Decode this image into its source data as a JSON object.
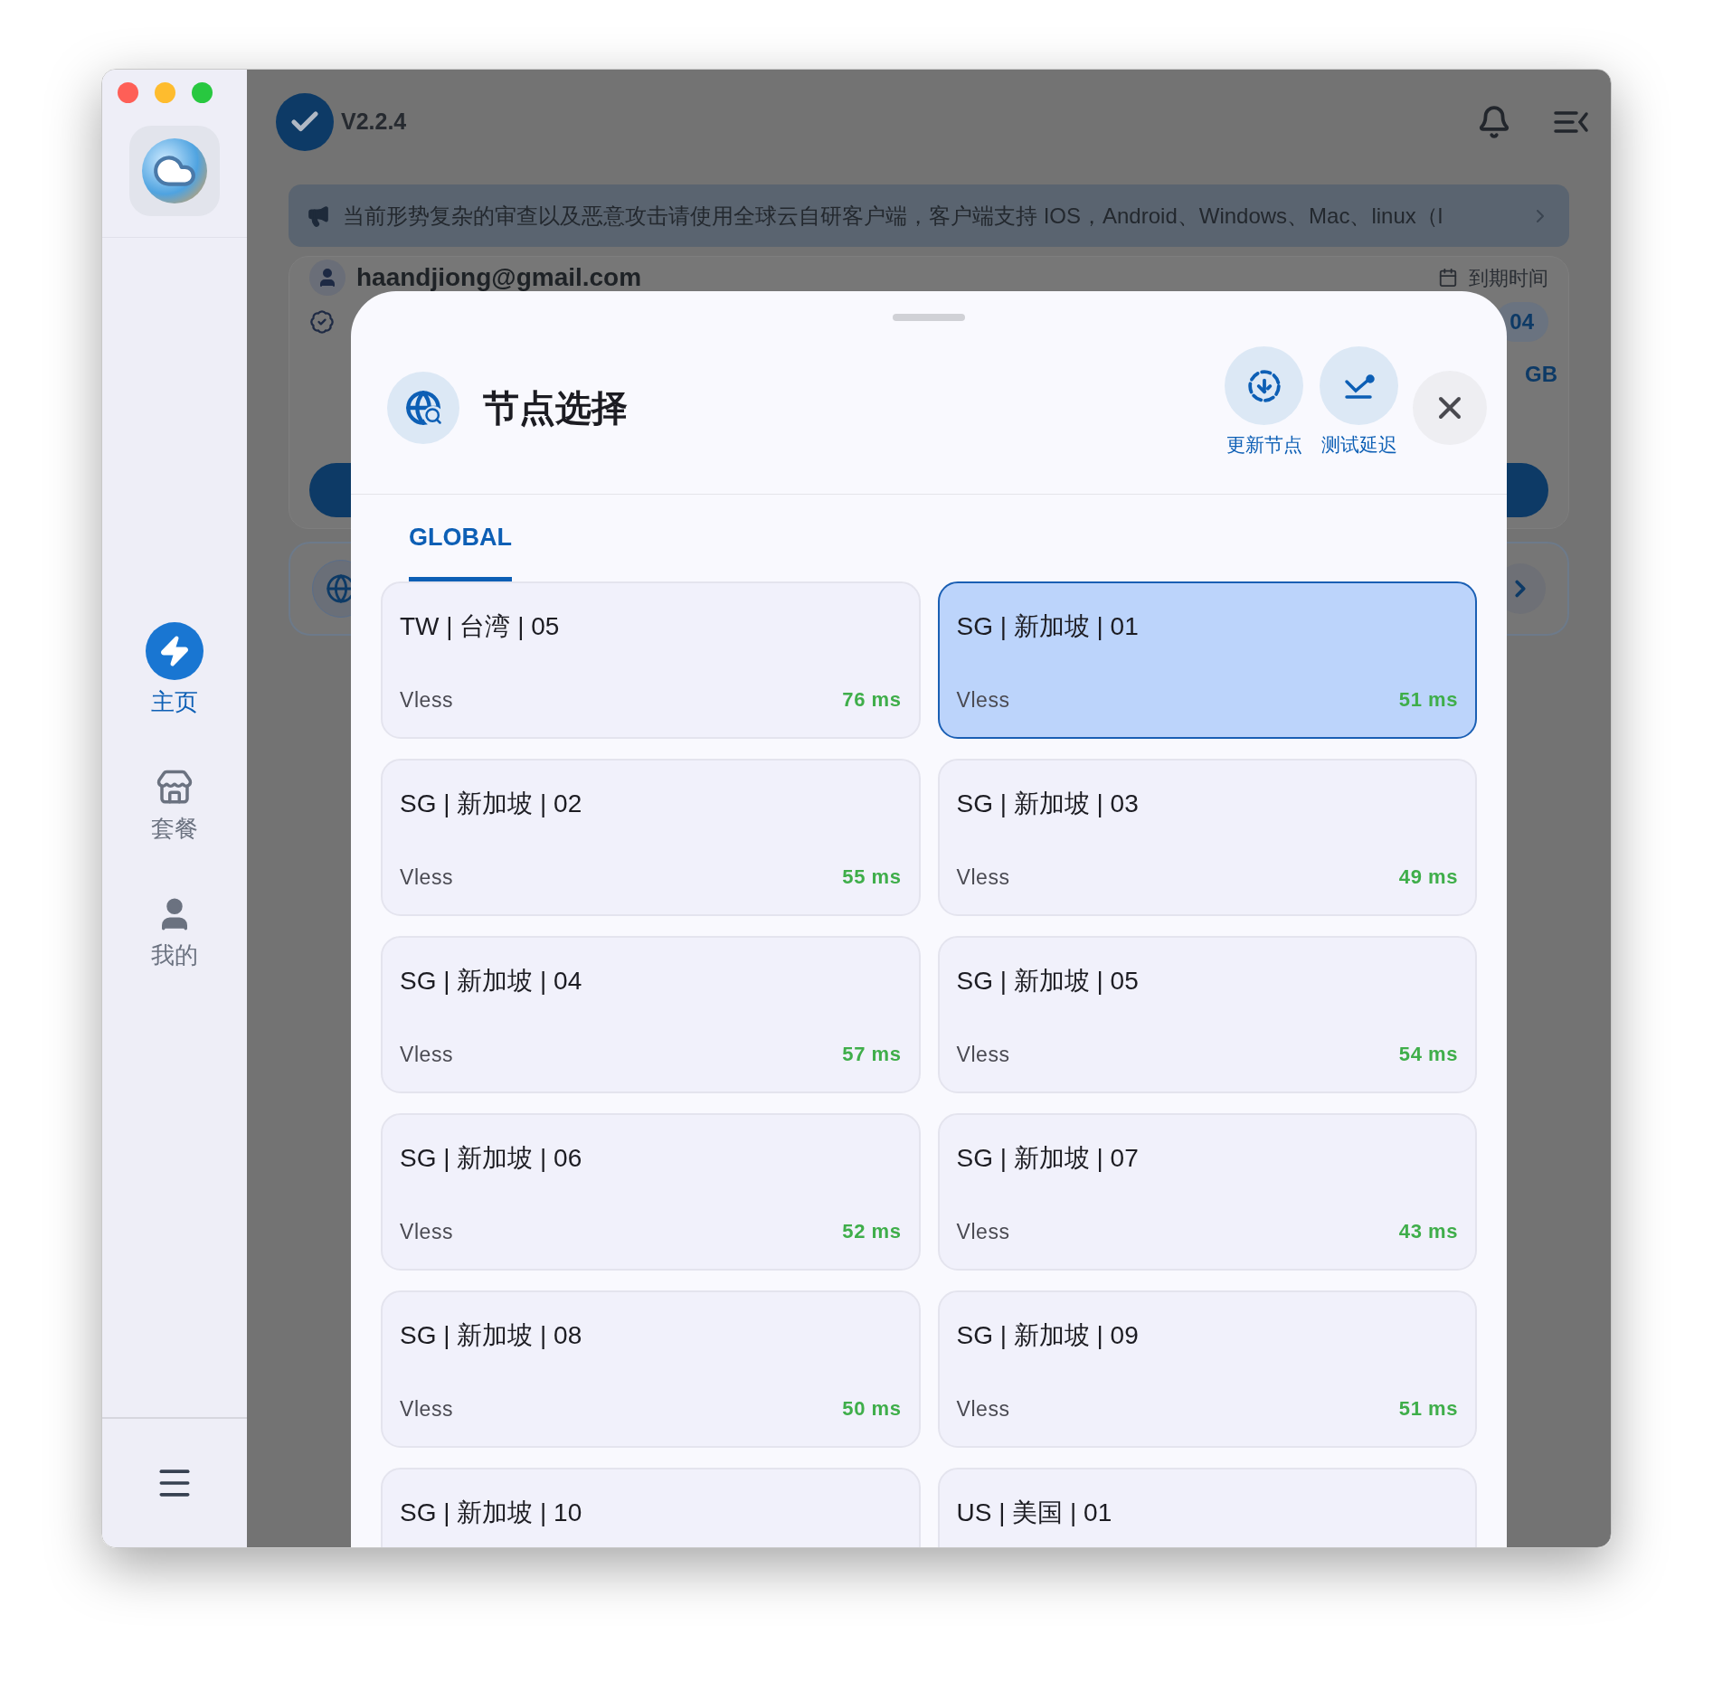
{
  "sidebar": {
    "items": [
      {
        "label": "主页",
        "kind": "home",
        "selected": true
      },
      {
        "label": "套餐",
        "kind": "plans",
        "selected": false
      },
      {
        "label": "我的",
        "kind": "profile",
        "selected": false
      }
    ]
  },
  "header": {
    "version": "V2.2.4"
  },
  "banner": {
    "text": "当前形势复杂的审查以及恶意攻击请使用全球云自研客户端，客户端支持 IOS，Android、Windows、Mac、linux（l"
  },
  "account": {
    "email": "haandjiong@gmail.com",
    "expiry_label": "到期时间",
    "expiry_value": "04",
    "traffic_value": "GB"
  },
  "node_picker": {
    "title": "节点选择",
    "actions": [
      {
        "label": "更新节点",
        "kind": "update"
      },
      {
        "label": "测试延迟",
        "kind": "latency"
      }
    ],
    "tabs": [
      {
        "label": "GLOBAL",
        "selected": true
      }
    ],
    "nodes": [
      {
        "name": "TW | 台湾 | 05",
        "protocol": "Vless",
        "latency": "76 ms",
        "selected": false
      },
      {
        "name": "SG | 新加坡 | 01",
        "protocol": "Vless",
        "latency": "51 ms",
        "selected": true
      },
      {
        "name": "SG | 新加坡 | 02",
        "protocol": "Vless",
        "latency": "55 ms",
        "selected": false
      },
      {
        "name": "SG | 新加坡 | 03",
        "protocol": "Vless",
        "latency": "49 ms",
        "selected": false
      },
      {
        "name": "SG | 新加坡 | 04",
        "protocol": "Vless",
        "latency": "57 ms",
        "selected": false
      },
      {
        "name": "SG | 新加坡 | 05",
        "protocol": "Vless",
        "latency": "54 ms",
        "selected": false
      },
      {
        "name": "SG | 新加坡 | 06",
        "protocol": "Vless",
        "latency": "52 ms",
        "selected": false
      },
      {
        "name": "SG | 新加坡 | 07",
        "protocol": "Vless",
        "latency": "43 ms",
        "selected": false
      },
      {
        "name": "SG | 新加坡 | 08",
        "protocol": "Vless",
        "latency": "50 ms",
        "selected": false
      },
      {
        "name": "SG | 新加坡 | 09",
        "protocol": "Vless",
        "latency": "51 ms",
        "selected": false
      },
      {
        "name": "SG | 新加坡 | 10",
        "selected": false
      },
      {
        "name": "US | 美国 | 01",
        "selected": false
      }
    ]
  }
}
